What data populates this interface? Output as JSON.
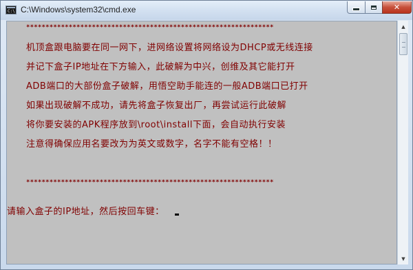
{
  "window": {
    "title": "C:\\Windows\\system32\\cmd.exe",
    "icon_name": "cmd-icon",
    "icon_glyph": "C:\\",
    "buttons": {
      "minimize": "minimize-icon",
      "maximize": "maximize-icon",
      "close": "close-icon",
      "close_glyph": "✕"
    }
  },
  "console": {
    "text_color": "#800000",
    "background": "#c0c0c0",
    "separator": "****************************************************************",
    "lines": [
      "机顶盒跟电脑要在同一网下，进网络设置将网络设为DHCP或无线连接",
      "并记下盒子IP地址在下方输入，此破解为中兴，创维及其它能打开",
      "ADB端口的大部份盒子破解，用悟空助手能连的一般ADB端口已打开",
      "如果出现破解不成功，请先将盒子恢复出厂，再尝试运行此破解",
      "将你要安装的APK程序放到\\root\\install下面，会自动执行安装",
      "注意得确保应用名要改为为英文或数字，名字不能有空格！！"
    ],
    "prompt": "请输入盒子的IP地址，然后按回车键："
  },
  "scrollbar": {
    "up_glyph": "▲",
    "down_glyph": "▼"
  }
}
